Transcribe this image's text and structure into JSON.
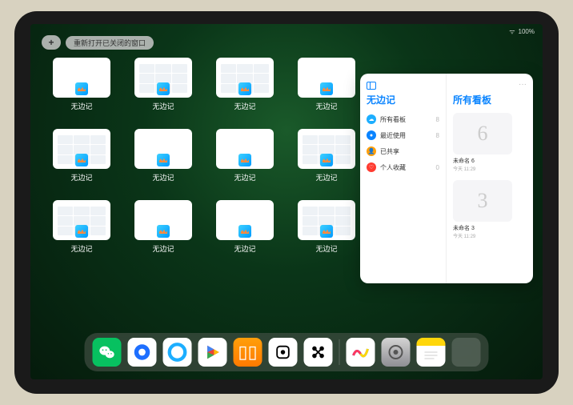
{
  "status": {
    "signal": "•ıll",
    "battery": "100%"
  },
  "topbar": {
    "add": "+",
    "reopen": "重新打开已关闭的窗口"
  },
  "grid": {
    "app_label": "无边记",
    "items": [
      {
        "type": "blank"
      },
      {
        "type": "calendar"
      },
      {
        "type": "calendar"
      },
      {
        "type": "blank"
      },
      {
        "type": "calendar"
      },
      {
        "type": "blank"
      },
      {
        "type": "blank"
      },
      {
        "type": "calendar"
      },
      {
        "type": "calendar"
      },
      {
        "type": "blank"
      },
      {
        "type": "blank"
      },
      {
        "type": "calendar"
      }
    ]
  },
  "popover": {
    "title": "无边记",
    "right_title": "所有看板",
    "more": "···",
    "rows": [
      {
        "color": "#1caeff",
        "symbol": "☁",
        "label": "所有看板",
        "count": "8"
      },
      {
        "color": "#0a84ff",
        "symbol": "●",
        "label": "最近使用",
        "count": "8"
      },
      {
        "color": "#ff9f0a",
        "symbol": "👤",
        "label": "已共享",
        "count": ""
      },
      {
        "color": "#ff3b30",
        "symbol": "♡",
        "label": "个人收藏",
        "count": "0"
      }
    ],
    "boards": [
      {
        "glyph": "6",
        "name": "未命名 6",
        "date": "今天 11:29"
      },
      {
        "glyph": "3",
        "name": "未命名 3",
        "date": "今天 11:29"
      }
    ]
  },
  "dock": {
    "apps": [
      "wechat",
      "qq",
      "browser",
      "play",
      "books",
      "bw",
      "dots"
    ],
    "recent": [
      "freeform",
      "settings",
      "notes",
      "apps"
    ]
  }
}
